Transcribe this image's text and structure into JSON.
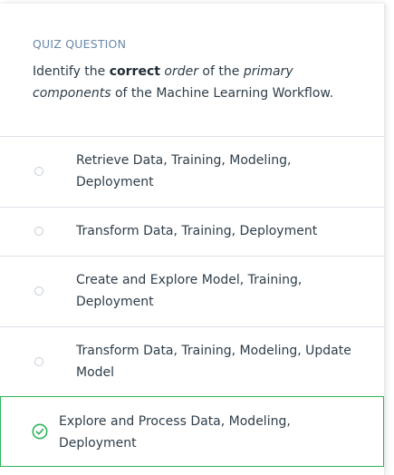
{
  "quiz": {
    "label": "QUIZ QUESTION",
    "prompt_parts": {
      "p1": "Identify the ",
      "bold": "correct",
      "p2": " ",
      "italic1": "order",
      "p3": " of the ",
      "italic2": "primary components",
      "p4": " of the Machine Learning Workflow."
    }
  },
  "options": [
    {
      "label": "Retrieve Data, Training, Modeling, Deployment",
      "selected": false
    },
    {
      "label": "Transform Data, Training, Deployment",
      "selected": false
    },
    {
      "label": "Create and Explore Model, Training, Deployment",
      "selected": false
    },
    {
      "label": "Transform Data, Training, Modeling, Update Model",
      "selected": false
    },
    {
      "label": "Explore and Process Data, Modeling, Deployment",
      "selected": true
    }
  ],
  "colors": {
    "correct": "#2fb45a",
    "label": "#6a89a8",
    "text": "#2e3d49"
  },
  "icons": {
    "correct": "check-circle-icon",
    "unselected": "radio-icon"
  }
}
